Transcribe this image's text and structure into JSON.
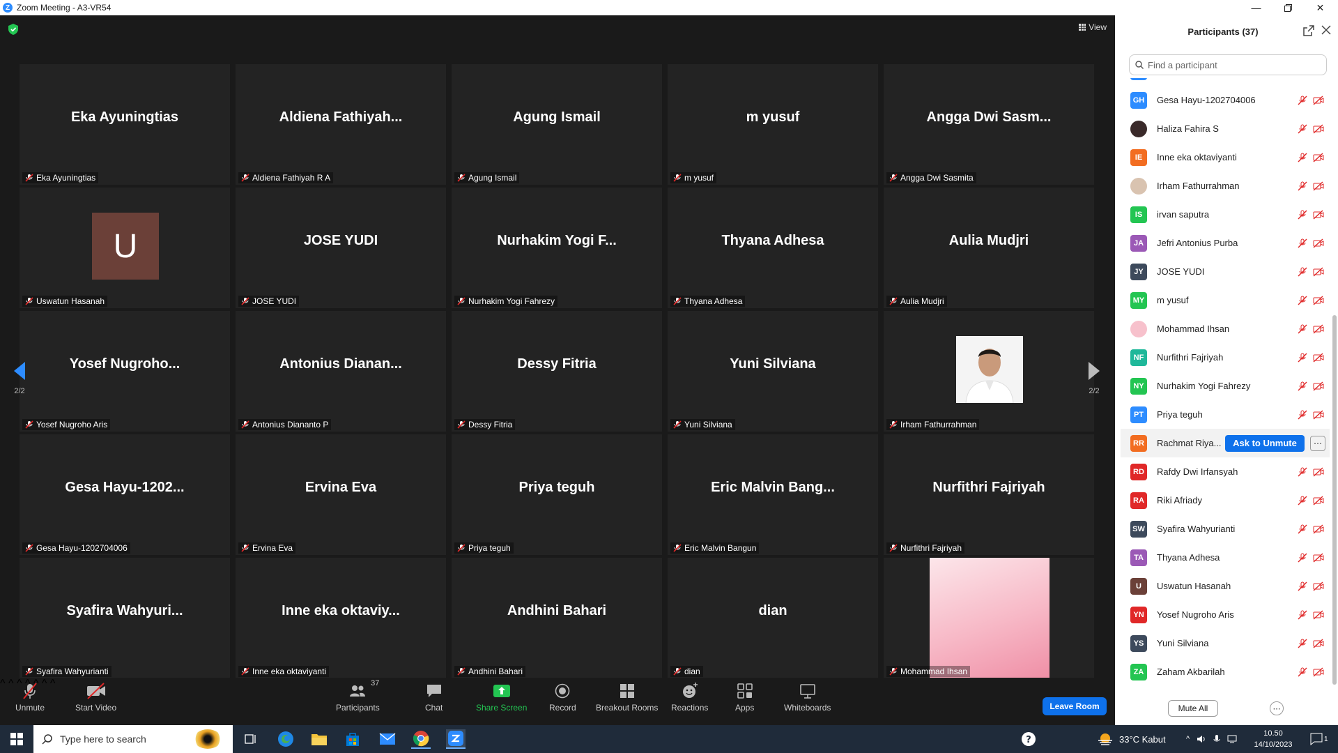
{
  "window": {
    "title": "Zoom Meeting - A3-VR54",
    "logo_letter": "Z"
  },
  "view_button": {
    "label": "View"
  },
  "tiles": [
    {
      "name": "Eka Ayuningtias",
      "label": "Eka Ayuningtias"
    },
    {
      "name": "Aldiena  Fathiyah...",
      "label": "Aldiena Fathiyah R A"
    },
    {
      "name": "Agung Ismail",
      "label": "Agung Ismail"
    },
    {
      "name": "m yusuf",
      "label": "m yusuf"
    },
    {
      "name": "Angga  Dwi  Sasm...",
      "label": "Angga Dwi Sasmita"
    },
    {
      "name": "U",
      "label": "Uswatun Hasanah",
      "kind": "initial"
    },
    {
      "name": "JOSE YUDI",
      "label": "JOSE YUDI"
    },
    {
      "name": "Nurhakim  Yogi  F...",
      "label": "Nurhakim Yogi Fahrezy"
    },
    {
      "name": "Thyana Adhesa",
      "label": "Thyana Adhesa"
    },
    {
      "name": "Aulia Mudjri",
      "label": "Aulia Mudjri"
    },
    {
      "name": "Yosef  Nugroho...",
      "label": "Yosef Nugroho Aris"
    },
    {
      "name": "Antonius  Dianan...",
      "label": "Antonius Dianantо P"
    },
    {
      "name": "Dessy Fitria",
      "label": "Dessy Fitria"
    },
    {
      "name": "Yuni Silviana",
      "label": "Yuni Silviana"
    },
    {
      "name": "",
      "label": "Irham Fathurrahman",
      "kind": "photo"
    },
    {
      "name": "Gesa  Hayu-1202...",
      "label": "Gesa Hayu-1202704006"
    },
    {
      "name": "Ervina Eva",
      "label": "Ervina Eva"
    },
    {
      "name": "Priya teguh",
      "label": "Priya teguh"
    },
    {
      "name": "Eric  Malvin  Bang...",
      "label": "Eric Malvin Bangun"
    },
    {
      "name": "Nurfithri Fajriyah",
      "label": "Nurfithri Fajriyah"
    },
    {
      "name": "Syafira  Wahyuri...",
      "label": "Syafira Wahyurianti"
    },
    {
      "name": "Inne  eka  oktaviy...",
      "label": "Inne eka oktaviyanti"
    },
    {
      "name": "Andhini Bahari",
      "label": "Andhini Bahari"
    },
    {
      "name": "dian",
      "label": "dian"
    },
    {
      "name": "",
      "label": "Mohammad Ihsan",
      "kind": "pink"
    }
  ],
  "page_indicator": {
    "left": "2/2",
    "right": "2/2"
  },
  "toolbar": {
    "unmute": "Unmute",
    "start_video": "Start Video",
    "participants": "Participants",
    "participants_count": "37",
    "chat": "Chat",
    "share_screen": "Share Screen",
    "record": "Record",
    "breakout_rooms": "Breakout Rooms",
    "reactions": "Reactions",
    "apps": "Apps",
    "whiteboards": "Whiteboards",
    "leave_room": "Leave Room"
  },
  "panel": {
    "title": "Participants (37)",
    "search_placeholder": "Find a participant",
    "mute_all": "Mute All",
    "ask_to_unmute": "Ask to Unmute",
    "participants": [
      {
        "initials": "GH",
        "name": "Gesa Hayu-1202704006",
        "color": "#2d8cff"
      },
      {
        "initials": "",
        "name": "Haliza Fahira S",
        "color": "#3a2a2a",
        "photo": true
      },
      {
        "initials": "IE",
        "name": "Inne eka oktaviyanti",
        "color": "#f26d21"
      },
      {
        "initials": "",
        "name": "Irham Fathurrahman",
        "color": "#d9c3b0",
        "photo": true
      },
      {
        "initials": "IS",
        "name": "irvan saputra",
        "color": "#23c552"
      },
      {
        "initials": "JA",
        "name": "Jefri Antonius Purba",
        "color": "#9b59b6"
      },
      {
        "initials": "JY",
        "name": "JOSE YUDI",
        "color": "#3d4a5c"
      },
      {
        "initials": "MY",
        "name": "m yusuf",
        "color": "#23c552"
      },
      {
        "initials": "",
        "name": "Mohammad Ihsan",
        "color": "#f7c1cc",
        "photo": true
      },
      {
        "initials": "NF",
        "name": "Nurfithri Fajriyah",
        "color": "#1fb89a"
      },
      {
        "initials": "NY",
        "name": "Nurhakim Yogi Fahrezy",
        "color": "#23c552"
      },
      {
        "initials": "PT",
        "name": "Priya teguh",
        "color": "#2d8cff"
      },
      {
        "initials": "RR",
        "name": "Rachmat Riya...",
        "color": "#f26d21",
        "hover": true
      },
      {
        "initials": "RD",
        "name": "Rafdy Dwi Irfansyah",
        "color": "#e02828"
      },
      {
        "initials": "RA",
        "name": "Riki Afriady",
        "color": "#e02828"
      },
      {
        "initials": "SW",
        "name": "Syafira Wahyurianti",
        "color": "#3d4a5c"
      },
      {
        "initials": "TA",
        "name": "Thyana Adhesa",
        "color": "#9b59b6"
      },
      {
        "initials": "U",
        "name": "Uswatun Hasanah",
        "color": "#6b4038"
      },
      {
        "initials": "YN",
        "name": "Yosef Nugroho Aris",
        "color": "#e02828"
      },
      {
        "initials": "YS",
        "name": "Yuni Silviana",
        "color": "#3d4a5c"
      },
      {
        "initials": "ZA",
        "name": "Zaham Akbarilah",
        "color": "#23c552"
      }
    ]
  },
  "taskbar": {
    "search_placeholder": "Type here to search",
    "weather": "33°C  Kabut",
    "time": "10.50",
    "date": "14/10/2023",
    "notifications": "1"
  },
  "colors": {
    "accent": "#0e71eb",
    "mic_off": "#e02828",
    "share_green": "#23c552"
  }
}
